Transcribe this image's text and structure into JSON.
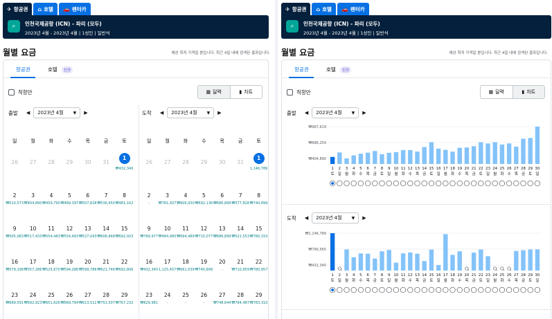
{
  "tabs": [
    {
      "icon": "✈",
      "label": "항공권"
    },
    {
      "icon": "⌂",
      "label": "호텔"
    },
    {
      "icon": "🚗",
      "label": "렌터카"
    }
  ],
  "search": {
    "route": "인천국제공항 (ICN) - 파리 (모두)",
    "meta": "2023년 4월 - 2023년 4월 | 1성인 | 일반석"
  },
  "section": {
    "title": "월별 요금",
    "note": "예상 최저 가격일 뿐입니다. 최근 4일 내에 검색된 결과입니다."
  },
  "card_tabs": {
    "flights": "항공권",
    "hotels": "호텔",
    "new_badge": "신규"
  },
  "direct_only": "직항만",
  "view": {
    "calendar": "달력",
    "chart": "차트"
  },
  "month_select": "2023년 4월",
  "labels": {
    "depart": "출발",
    "return": "도착"
  },
  "weekdays": [
    "일",
    "월",
    "화",
    "수",
    "목",
    "금",
    "토"
  ],
  "calendar": {
    "depart": [
      {
        "d": "26",
        "p": "",
        "muted": true
      },
      {
        "d": "27",
        "p": "",
        "muted": true
      },
      {
        "d": "28",
        "p": "",
        "muted": true
      },
      {
        "d": "29",
        "p": "",
        "muted": true
      },
      {
        "d": "30",
        "p": "",
        "muted": true
      },
      {
        "d": "31",
        "p": "",
        "muted": true
      },
      {
        "d": "1",
        "p": "₩432,340",
        "sel": true
      },
      {
        "d": "2",
        "p": "₩510,573"
      },
      {
        "d": "3",
        "p": "₩404,890"
      },
      {
        "d": "4",
        "p": "₩459,790"
      },
      {
        "d": "5",
        "p": "₩489,397"
      },
      {
        "d": "6",
        "p": "₩507,828"
      },
      {
        "d": "7",
        "p": "₩536,650"
      },
      {
        "d": "8",
        "p": "₩481,162"
      },
      {
        "d": "9",
        "p": "₩505,083"
      },
      {
        "d": "10",
        "p": "₩517,433"
      },
      {
        "d": "11",
        "p": "₩554,483"
      },
      {
        "d": "12",
        "p": "₩554,483"
      },
      {
        "d": "13",
        "p": "₩527,043"
      },
      {
        "d": "14",
        "p": "₩606,848"
      },
      {
        "d": "15",
        "p": "₩692,923"
      },
      {
        "d": "16",
        "p": "₩579,198"
      },
      {
        "d": "17",
        "p": "₩557,286"
      },
      {
        "d": "18",
        "p": "₩525,670"
      },
      {
        "d": "19",
        "p": "₩594,286"
      },
      {
        "d": "20",
        "p": "₩599,786"
      },
      {
        "d": "21",
        "p": "₩621,746"
      },
      {
        "d": "22",
        "p": "₩692,806"
      },
      {
        "d": "23",
        "p": "₩669,591"
      },
      {
        "d": "24",
        "p": "₩692,923"
      },
      {
        "d": "25",
        "p": "₩651,626"
      },
      {
        "d": "26",
        "p": "₩669,784"
      },
      {
        "d": "27",
        "p": "₩613,511"
      },
      {
        "d": "28",
        "p": "₩753,507"
      },
      {
        "d": "29",
        "p": "₩767,232"
      }
    ],
    "return": [
      {
        "d": "26",
        "p": "",
        "muted": true
      },
      {
        "d": "27",
        "p": "",
        "muted": true
      },
      {
        "d": "28",
        "p": "",
        "muted": true
      },
      {
        "d": "29",
        "p": "",
        "muted": true
      },
      {
        "d": "30",
        "p": "",
        "muted": true
      },
      {
        "d": "31",
        "p": "",
        "muted": true
      },
      {
        "d": "1",
        "p": "1,146,789",
        "sel": true
      },
      {
        "d": "2",
        "p": "-"
      },
      {
        "d": "3",
        "p": "₩781,937"
      },
      {
        "d": "4",
        "p": "₩606,930"
      },
      {
        "d": "5",
        "p": "₩692,136"
      },
      {
        "d": "6",
        "p": "₩686,899"
      },
      {
        "d": "7",
        "p": "₩577,828"
      },
      {
        "d": "8",
        "p": "₩740,899"
      },
      {
        "d": "9",
        "p": "₩769,977"
      },
      {
        "d": "10",
        "p": "₩484,480"
      },
      {
        "d": "11",
        "p": "₩694,489"
      },
      {
        "d": "12",
        "p": "₩715,077"
      },
      {
        "d": "13",
        "p": "₩686,899"
      },
      {
        "d": "14",
        "p": "₩521,553"
      },
      {
        "d": "15",
        "p": "₩780,310"
      },
      {
        "d": "16",
        "p": "₩432,340"
      },
      {
        "d": "17",
        "p": "1,125,457"
      },
      {
        "d": "18",
        "p": "₩661,039"
      },
      {
        "d": "19",
        "p": "₩740,899"
      },
      {
        "d": "20",
        "p": "-"
      },
      {
        "d": "21",
        "p": "₩710,959"
      },
      {
        "d": "22",
        "p": "₩780,957"
      },
      {
        "d": "23",
        "p": "₩629,981"
      },
      {
        "d": "24",
        "p": "-"
      },
      {
        "d": "25",
        "p": "-"
      },
      {
        "d": "26",
        "p": "-"
      },
      {
        "d": "27",
        "p": "₩748,644"
      },
      {
        "d": "28",
        "p": "₩764,487"
      },
      {
        "d": "29",
        "p": "₩783,310"
      }
    ]
  },
  "chart_data": [
    {
      "type": "bar",
      "title": "출발",
      "x": [
        1,
        2,
        3,
        4,
        5,
        6,
        7,
        8,
        9,
        10,
        11,
        12,
        13,
        14,
        15,
        16,
        17,
        18,
        19,
        20,
        21,
        22,
        23,
        24,
        25,
        26,
        27,
        28,
        29,
        30
      ],
      "dow": [
        "토",
        "일",
        "월",
        "화",
        "수",
        "목",
        "금",
        "토",
        "일",
        "월",
        "화",
        "수",
        "목",
        "금",
        "토",
        "일",
        "월",
        "화",
        "수",
        "목",
        "금",
        "토",
        "일",
        "월",
        "화",
        "수",
        "목",
        "금",
        "토",
        "일"
      ],
      "values": [
        432340,
        510573,
        404890,
        459790,
        489397,
        507828,
        536650,
        481162,
        505083,
        517433,
        554483,
        554483,
        527043,
        606848,
        692923,
        579198,
        557286,
        525670,
        594286,
        599786,
        621746,
        692806,
        669591,
        692923,
        651626,
        669784,
        613511,
        753507,
        767232,
        967619
      ],
      "selected": 1,
      "yticks": [
        {
          "v": 404890,
          "label": "₩404,890"
        },
        {
          "v": 686254,
          "label": "₩686,254"
        },
        {
          "v": 967619,
          "label": "₩967,619"
        }
      ],
      "ylim": [
        404890,
        967619
      ],
      "colors": {
        "bar": "#84c3f9",
        "selected": "#0770e3"
      }
    },
    {
      "type": "bar",
      "title": "도착",
      "x": [
        1,
        2,
        3,
        4,
        5,
        6,
        7,
        8,
        9,
        10,
        11,
        12,
        13,
        14,
        15,
        16,
        17,
        18,
        19,
        20,
        21,
        22,
        23,
        24,
        25,
        26,
        27,
        28,
        29,
        30
      ],
      "dow": [
        "토",
        "일",
        "월",
        "화",
        "수",
        "목",
        "금",
        "토",
        "일",
        "월",
        "화",
        "수",
        "목",
        "금",
        "토",
        "일",
        "월",
        "화",
        "수",
        "목",
        "금",
        "토",
        "일",
        "월",
        "화",
        "수",
        "목",
        "금",
        "토",
        "일"
      ],
      "values": [
        1146789,
        null,
        781937,
        606930,
        692136,
        686899,
        577828,
        740899,
        769977,
        484480,
        694489,
        715077,
        686899,
        521553,
        780310,
        432340,
        1125457,
        661039,
        740899,
        null,
        710959,
        780957,
        629981,
        null,
        null,
        null,
        748644,
        764487,
        783310,
        783310
      ],
      "selected": 1,
      "yticks": [
        {
          "v": 432340,
          "label": "₩432,340"
        },
        {
          "v": 790565,
          "label": "₩790,565"
        },
        {
          "v": 1146789,
          "label": "₩1,146,789"
        }
      ],
      "ylim": [
        432340,
        1146789
      ],
      "colors": {
        "bar": "#84c3f9",
        "selected": "#0770e3"
      }
    }
  ]
}
